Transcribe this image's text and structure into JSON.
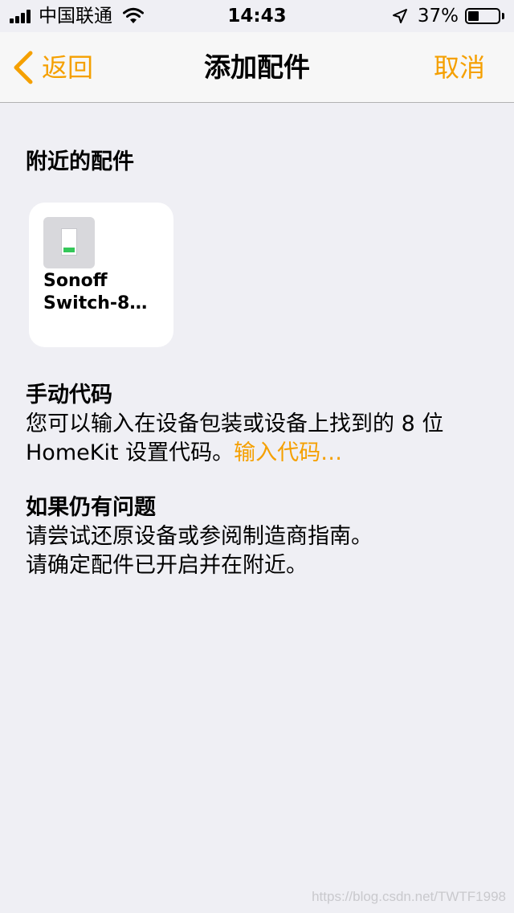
{
  "status_bar": {
    "carrier": "中国联通",
    "time": "14:43",
    "battery_percent": "37%",
    "battery_level": 0.37,
    "icons": [
      "signal-icon",
      "wifi-icon",
      "location-arrow-icon",
      "battery-icon"
    ]
  },
  "nav": {
    "back_label": "返回",
    "title": "添加配件",
    "cancel_label": "取消"
  },
  "nearby": {
    "header": "附近的配件",
    "accessories": [
      {
        "name": "Sonoff\nSwitch-8…",
        "icon": "switch-icon"
      }
    ]
  },
  "manual_code": {
    "header": "手动代码",
    "text": "您可以输入在设备包装或设备上找到的 8 位 HomeKit 设置代码。",
    "link": "输入代码…"
  },
  "problems": {
    "header": "如果仍有问题",
    "line1": "请尝试还原设备或参阅制造商指南。",
    "line2": "请确定配件已开启并在附近。"
  },
  "watermark": "https://blog.csdn.net/TWTF1998",
  "colors": {
    "accent": "#f5a000",
    "background": "#efeff4",
    "card": "#ffffff",
    "led": "#34c759"
  }
}
